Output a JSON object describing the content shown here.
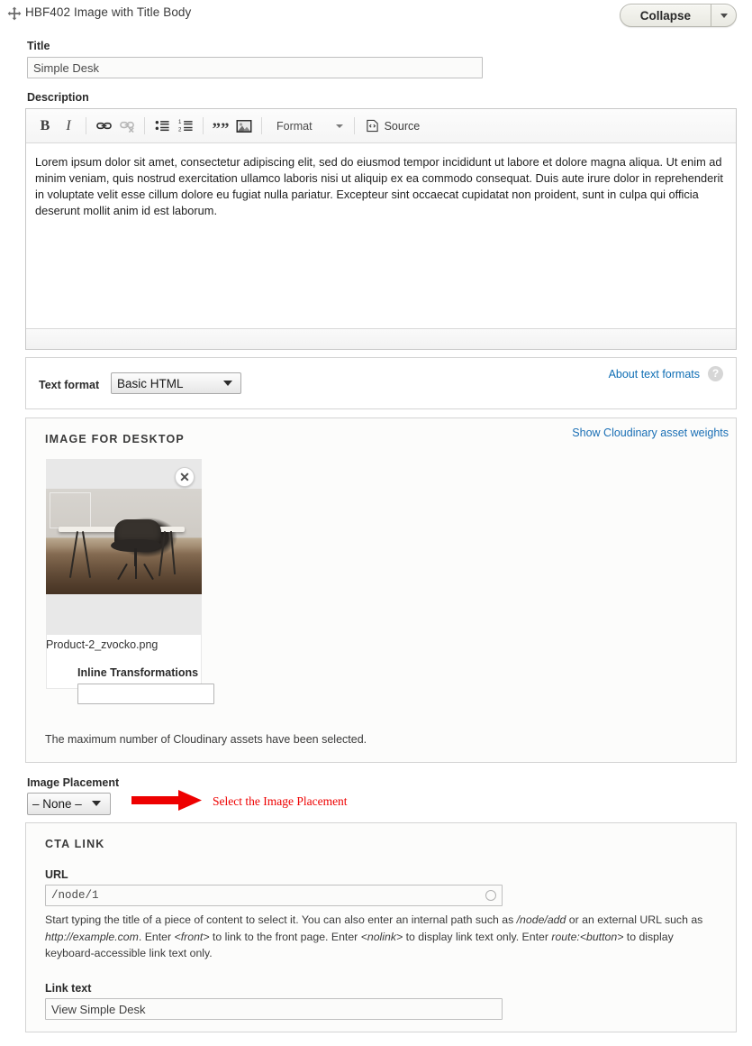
{
  "header": {
    "drag_handle_icon": "move-icon",
    "title": "HBF402 Image with Title Body",
    "collapse_label": "Collapse",
    "collapse_dropdown_icon": "chevron-down-icon"
  },
  "title_field": {
    "label": "Title",
    "value": "Simple Desk"
  },
  "description_field": {
    "label": "Description",
    "toolbar": {
      "bold": "B",
      "italic": "I",
      "link_icon": "link-icon",
      "unlink_icon": "unlink-icon",
      "bulleted_list_icon": "bulleted-list-icon",
      "numbered_list_icon": "numbered-list-icon",
      "blockquote": "””",
      "image_icon": "image-icon",
      "format_label": "Format",
      "format_caret_icon": "chevron-down-icon",
      "source_label": "Source",
      "source_icon": "source-code-icon"
    },
    "body": "Lorem ipsum dolor sit amet, consectetur adipiscing elit, sed do eiusmod tempor incididunt ut labore et dolore magna aliqua. Ut enim ad minim veniam, quis nostrud exercitation ullamco laboris nisi ut aliquip ex ea commodo consequat. Duis aute irure dolor in reprehenderit in voluptate velit esse cillum dolore eu fugiat nulla pariatur. Excepteur sint occaecat cupidatat non proident, sunt in culpa qui officia deserunt mollit anim id est laborum."
  },
  "text_format": {
    "label": "Text format",
    "selected": "Basic HTML",
    "options": [
      "Basic HTML"
    ],
    "about_link": "About text formats",
    "help_icon": "question-mark-icon"
  },
  "image_for_desktop": {
    "title": "IMAGE FOR DESKTOP",
    "show_weights_link": "Show Cloudinary asset weights",
    "asset": {
      "filename": "Product-2_zvocko.png",
      "remove_icon": "close-icon",
      "alt": "Simple desk with chair"
    },
    "inline_transformations": {
      "label": "Inline Transformations",
      "value": "",
      "placeholder": ""
    },
    "max_assets_message": "The maximum number of Cloudinary assets have been selected."
  },
  "image_placement": {
    "label": "Image Placement",
    "selected": "– None –",
    "options": [
      "– None –"
    ]
  },
  "annotation": {
    "text": "Select the Image Placement",
    "color": "#ee0000",
    "arrow_icon": "right-arrow-icon"
  },
  "cta_link": {
    "title": "CTA LINK",
    "url": {
      "label": "URL",
      "value": "/node/1",
      "throbber_icon": "autocomplete-throbber-icon",
      "description_parts": [
        {
          "text": "Start typing the title of a piece of content to select it. You can also enter an internal path such as ",
          "italic": false
        },
        {
          "text": "/node/add",
          "italic": true
        },
        {
          "text": " or an external URL such as ",
          "italic": false
        },
        {
          "text": "http://example.com",
          "italic": true
        },
        {
          "text": ". Enter ",
          "italic": false
        },
        {
          "text": "<front>",
          "italic": true
        },
        {
          "text": " to link to the front page. Enter ",
          "italic": false
        },
        {
          "text": "<nolink>",
          "italic": true
        },
        {
          "text": " to display link text only. Enter ",
          "italic": false
        },
        {
          "text": "route:<button>",
          "italic": true
        },
        {
          "text": " to display keyboard-accessible link text only.",
          "italic": false
        }
      ]
    },
    "link_text": {
      "label": "Link text",
      "value": "View Simple Desk"
    }
  },
  "colors": {
    "link_blue": "#1a6fb5",
    "annotation_red": "#ee0000",
    "panel_border": "#d4d4d4",
    "page_background": "#ffffff"
  }
}
